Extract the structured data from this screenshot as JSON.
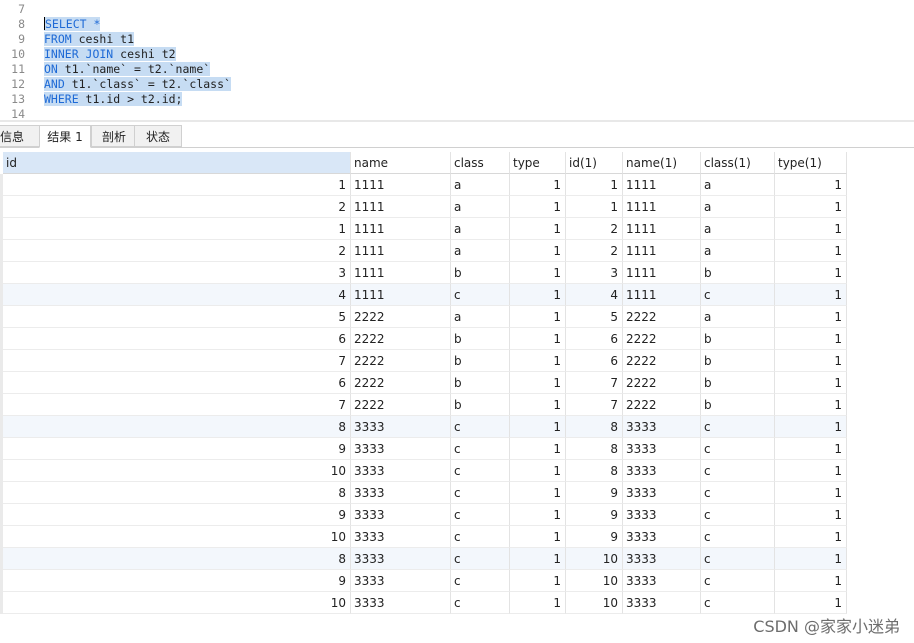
{
  "editor": {
    "lines": [
      {
        "no": "7",
        "tokens": []
      },
      {
        "no": "8",
        "tokens": [
          {
            "t": "SELECT *",
            "k": "kw"
          }
        ]
      },
      {
        "no": "9",
        "tokens": [
          {
            "t": "FROM",
            "k": "kw"
          },
          {
            "t": " ceshi t1",
            "k": "plain"
          }
        ]
      },
      {
        "no": "10",
        "tokens": [
          {
            "t": "INNER JOIN",
            "k": "kw"
          },
          {
            "t": " ceshi t2",
            "k": "plain"
          }
        ]
      },
      {
        "no": "11",
        "tokens": [
          {
            "t": "ON",
            "k": "kw"
          },
          {
            "t": " t1.`name` = t2.`name`",
            "k": "plain"
          }
        ]
      },
      {
        "no": "12",
        "tokens": [
          {
            "t": "AND",
            "k": "kw"
          },
          {
            "t": " t1.`class` = t2.`class`",
            "k": "plain"
          }
        ]
      },
      {
        "no": "13",
        "tokens": [
          {
            "t": "WHERE",
            "k": "kw"
          },
          {
            "t": " t1.id > t2.id;",
            "k": "plain"
          }
        ]
      },
      {
        "no": "14",
        "tokens": []
      }
    ]
  },
  "tabs": [
    {
      "label": "信息",
      "active": false
    },
    {
      "label": "结果 1",
      "active": true
    },
    {
      "label": "剖析",
      "active": false
    },
    {
      "label": "状态",
      "active": false
    }
  ],
  "grid": {
    "columns": [
      "id",
      "name",
      "class",
      "type",
      "id(1)",
      "name(1)",
      "class(1)",
      "type(1)"
    ],
    "rows": [
      [
        "1",
        "1111",
        "a",
        "1",
        "1",
        "1111",
        "a",
        "1"
      ],
      [
        "2",
        "1111",
        "a",
        "1",
        "1",
        "1111",
        "a",
        "1"
      ],
      [
        "1",
        "1111",
        "a",
        "1",
        "2",
        "1111",
        "a",
        "1"
      ],
      [
        "2",
        "1111",
        "a",
        "1",
        "2",
        "1111",
        "a",
        "1"
      ],
      [
        "3",
        "1111",
        "b",
        "1",
        "3",
        "1111",
        "b",
        "1"
      ],
      [
        "4",
        "1111",
        "c",
        "1",
        "4",
        "1111",
        "c",
        "1"
      ],
      [
        "5",
        "2222",
        "a",
        "1",
        "5",
        "2222",
        "a",
        "1"
      ],
      [
        "6",
        "2222",
        "b",
        "1",
        "6",
        "2222",
        "b",
        "1"
      ],
      [
        "7",
        "2222",
        "b",
        "1",
        "6",
        "2222",
        "b",
        "1"
      ],
      [
        "6",
        "2222",
        "b",
        "1",
        "7",
        "2222",
        "b",
        "1"
      ],
      [
        "7",
        "2222",
        "b",
        "1",
        "7",
        "2222",
        "b",
        "1"
      ],
      [
        "8",
        "3333",
        "c",
        "1",
        "8",
        "3333",
        "c",
        "1"
      ],
      [
        "9",
        "3333",
        "c",
        "1",
        "8",
        "3333",
        "c",
        "1"
      ],
      [
        "10",
        "3333",
        "c",
        "1",
        "8",
        "3333",
        "c",
        "1"
      ],
      [
        "8",
        "3333",
        "c",
        "1",
        "9",
        "3333",
        "c",
        "1"
      ],
      [
        "9",
        "3333",
        "c",
        "1",
        "9",
        "3333",
        "c",
        "1"
      ],
      [
        "10",
        "3333",
        "c",
        "1",
        "9",
        "3333",
        "c",
        "1"
      ],
      [
        "8",
        "3333",
        "c",
        "1",
        "10",
        "3333",
        "c",
        "1"
      ],
      [
        "9",
        "3333",
        "c",
        "1",
        "10",
        "3333",
        "c",
        "1"
      ],
      [
        "10",
        "3333",
        "c",
        "1",
        "10",
        "3333",
        "c",
        "1"
      ]
    ]
  },
  "watermark": "CSDN @家家小迷弟"
}
